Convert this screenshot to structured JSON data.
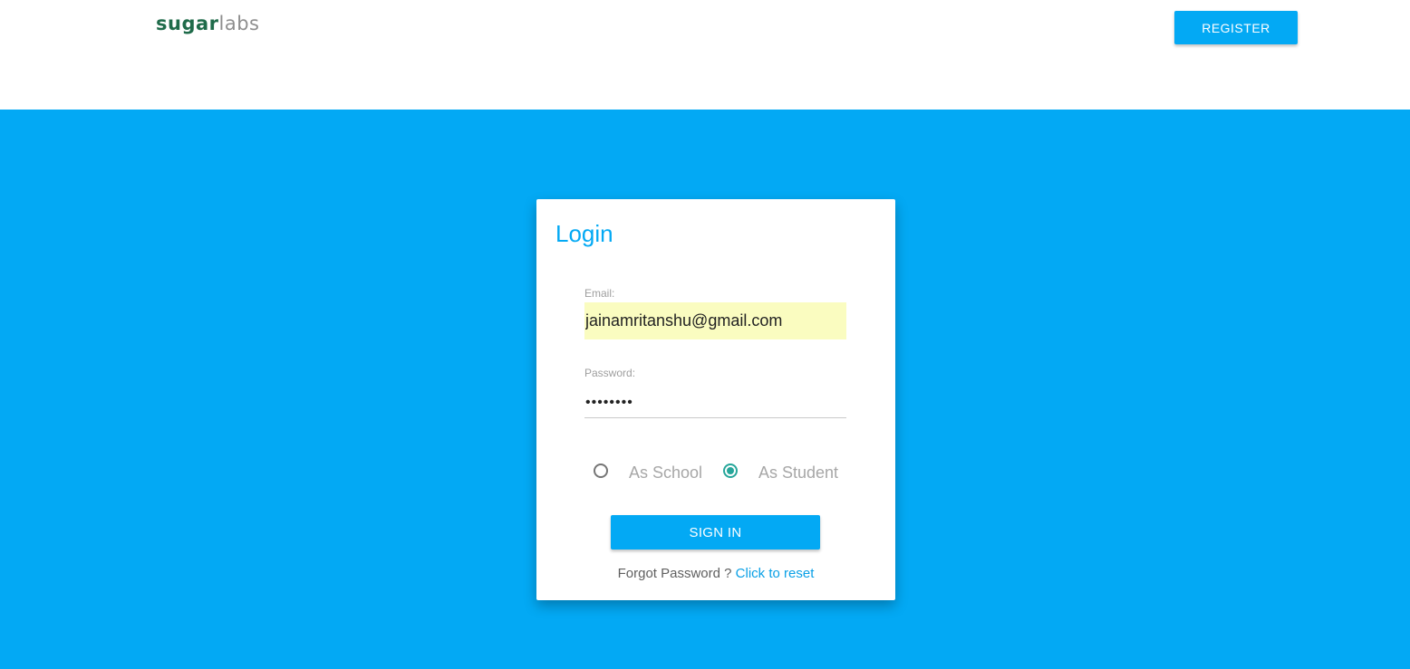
{
  "header": {
    "logo": {
      "part1": "sugar",
      "part2": "labs"
    },
    "register_label": "REGISTER"
  },
  "login": {
    "title": "Login",
    "email": {
      "label": "Email:",
      "value": "jainamritanshu@gmail.com"
    },
    "password": {
      "label": "Password:",
      "value": "••••••••"
    },
    "roles": {
      "school_label": "As School",
      "student_label": "As Student",
      "selected": "student"
    },
    "signin_label": "SIGN IN",
    "forgot": {
      "text": "Forgot Password ?",
      "link_label": "Click to reset"
    }
  },
  "colors": {
    "accent": "#03a9f4",
    "radio_selected": "#26a69a",
    "autofill": "#fafcc0",
    "logo_sugar": "#1f6b4a",
    "logo_labs": "#8e8e8e"
  }
}
